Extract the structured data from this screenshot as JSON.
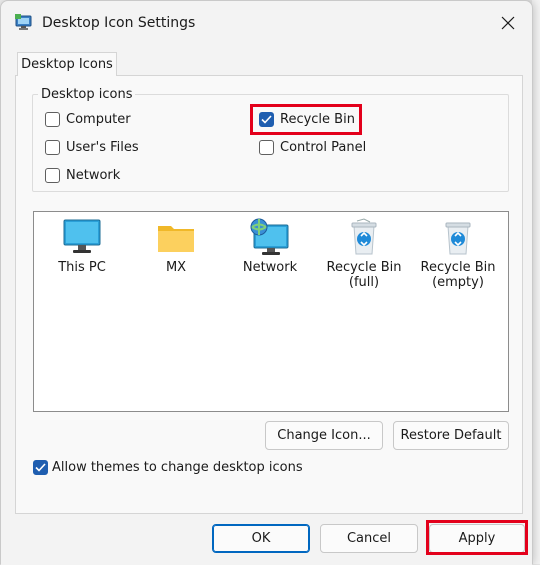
{
  "window": {
    "title": "Desktop Icon Settings",
    "close_glyph": "✕"
  },
  "tabs": [
    {
      "label": "Desktop Icons",
      "active": true
    }
  ],
  "desktop_icons_group": {
    "legend": "Desktop icons",
    "checkboxes": [
      {
        "label": "Computer",
        "checked": false
      },
      {
        "label": "User's Files",
        "checked": false
      },
      {
        "label": "Network",
        "checked": false
      },
      {
        "label": "Recycle Bin",
        "checked": true
      },
      {
        "label": "Control Panel",
        "checked": false
      }
    ]
  },
  "icon_list": [
    {
      "label": "This PC",
      "icon": "monitor-icon"
    },
    {
      "label": "MX",
      "icon": "folder-icon"
    },
    {
      "label": "Network",
      "icon": "network-icon"
    },
    {
      "label": "Recycle Bin\n(full)",
      "icon": "recycle-bin-full-icon"
    },
    {
      "label": "Recycle Bin\n(empty)",
      "icon": "recycle-bin-empty-icon"
    }
  ],
  "buttons": {
    "change_icon": "Change Icon...",
    "restore_default": "Restore Default",
    "ok": "OK",
    "cancel": "Cancel",
    "apply": "Apply"
  },
  "allow_themes": {
    "label": "Allow themes to change desktop icons",
    "checked": true
  },
  "colors": {
    "accent": "#1f5eb0",
    "highlight": "#e3001b"
  }
}
